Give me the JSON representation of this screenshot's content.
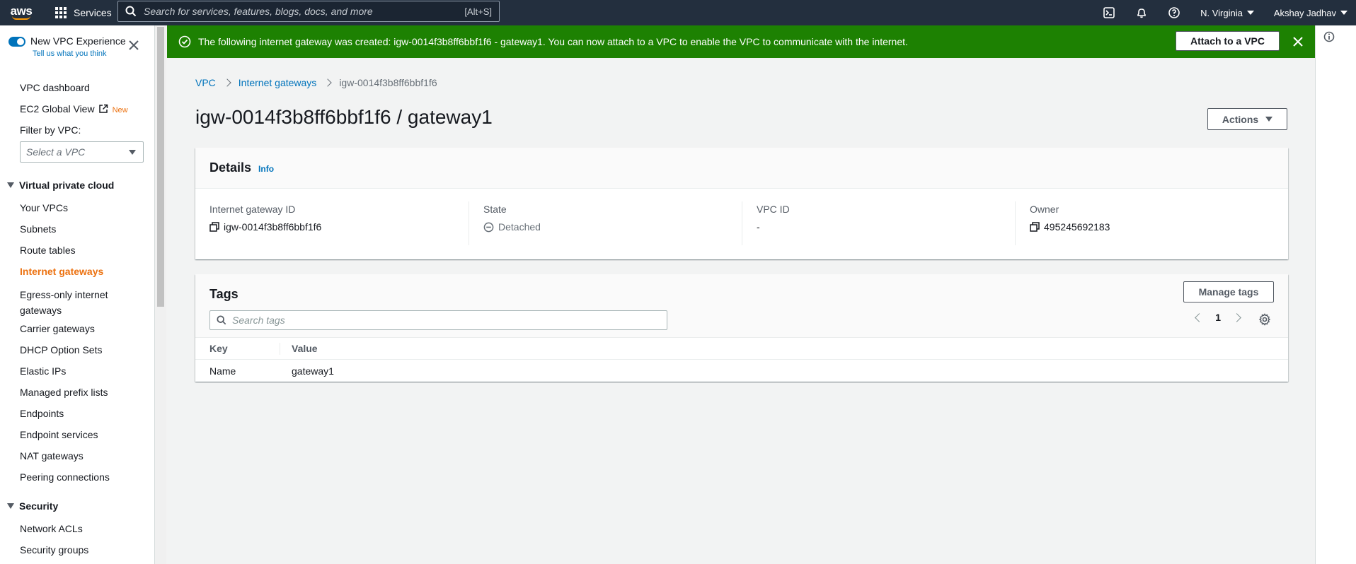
{
  "topnav": {
    "logo_text": "aws",
    "services_label": "Services",
    "search_placeholder": "Search for services, features, blogs, docs, and more",
    "search_shortcut": "[Alt+S]",
    "region_label": "N. Virginia",
    "user_label": "Akshay Jadhav",
    "icons": [
      "cloudshell-icon",
      "bell-icon",
      "help-icon"
    ]
  },
  "sidebar": {
    "vpc_experience_label": "New VPC Experience",
    "vpc_experience_sub": "Tell us what you think",
    "vpc_experience_on": true,
    "vpc_dashboard": "VPC dashboard",
    "ec2_global_view": "EC2 Global View",
    "new_badge": "New",
    "filter_label": "Filter by VPC:",
    "filter_placeholder": "Select a VPC",
    "section_vpc": "Virtual private cloud",
    "vpc_items": [
      "Your VPCs",
      "Subnets",
      "Route tables",
      "Internet gateways",
      "Egress-only internet gateways",
      "Carrier gateways",
      "DHCP Option Sets",
      "Elastic IPs",
      "Managed prefix lists",
      "Endpoints",
      "Endpoint services",
      "NAT gateways",
      "Peering connections"
    ],
    "active_item": "Internet gateways",
    "section_security": "Security",
    "security_items": [
      "Network ACLs",
      "Security groups"
    ]
  },
  "flash": {
    "message": "The following internet gateway was created: igw-0014f3b8ff6bbf1f6 - gateway1. You can now attach to a VPC to enable the VPC to communicate with the internet.",
    "action_label": "Attach to a VPC",
    "type": "success",
    "color": "#1d8102"
  },
  "breadcrumb": {
    "items": [
      "VPC",
      "Internet gateways"
    ],
    "current": "igw-0014f3b8ff6bbf1f6"
  },
  "page": {
    "title": "igw-0014f3b8ff6bbf1f6 / gateway1",
    "actions_label": "Actions"
  },
  "details": {
    "title": "Details",
    "info_label": "Info",
    "fields": [
      {
        "key": "Internet gateway ID",
        "value": "igw-0014f3b8ff6bbf1f6",
        "icon": "copy-icon"
      },
      {
        "key": "State",
        "value": "Detached",
        "icon": "detached-status-icon"
      },
      {
        "key": "VPC ID",
        "value": "-"
      },
      {
        "key": "Owner",
        "value": "495245692183",
        "icon": "copy-icon"
      }
    ]
  },
  "tags": {
    "title": "Tags",
    "manage_label": "Manage tags",
    "search_placeholder": "Search tags",
    "page_number": "1",
    "columns": [
      "Key",
      "Value"
    ],
    "rows": [
      {
        "key": "Name",
        "value": "gateway1"
      }
    ]
  },
  "colors": {
    "accent": "#0073bb",
    "active_nav": "#ec7211",
    "nav_bg": "#232f3e",
    "success": "#1d8102"
  }
}
